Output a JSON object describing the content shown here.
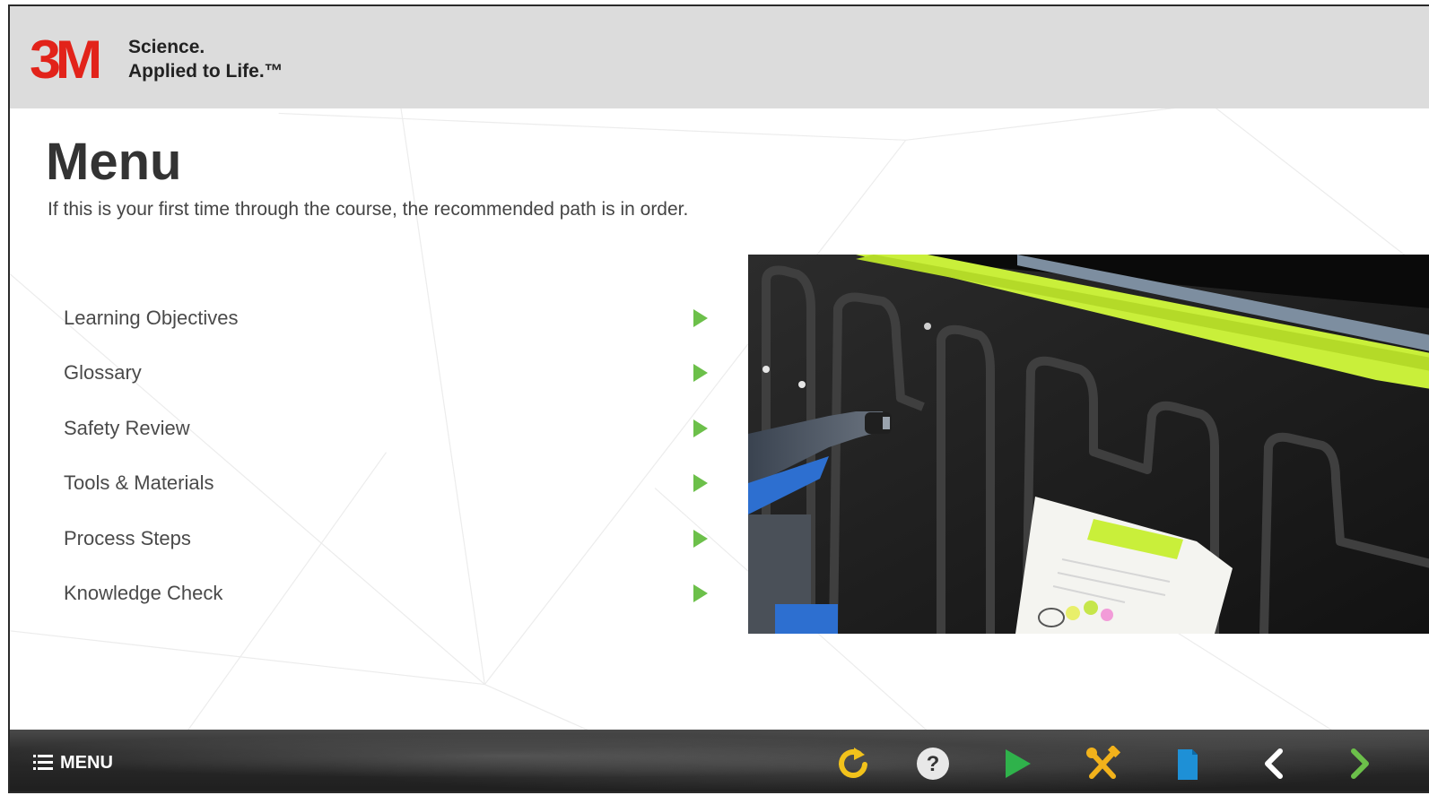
{
  "header": {
    "logo_text": "3M",
    "tagline_line1": "Science.",
    "tagline_line2": "Applied to Life.™"
  },
  "main": {
    "title": "Menu",
    "intro": "If this is your first time through the course, the recommended path is in order.",
    "menu_items": [
      {
        "label": "Learning Objectives"
      },
      {
        "label": "Glossary"
      },
      {
        "label": "Safety Review"
      },
      {
        "label": "Tools & Materials"
      },
      {
        "label": "Process Steps"
      },
      {
        "label": "Knowledge Check"
      }
    ]
  },
  "footer": {
    "menu_label": "MENU",
    "icons": [
      "replay-icon",
      "help-icon",
      "play-icon",
      "tools-icon",
      "document-icon",
      "back-arrow-icon",
      "next-arrow-icon"
    ]
  },
  "colors": {
    "brand_red": "#e2231a",
    "accent_green": "#6cc04a",
    "icon_yellow": "#f2c21b",
    "icon_blue": "#1e90d6",
    "header_grey": "#dcdcdc"
  }
}
